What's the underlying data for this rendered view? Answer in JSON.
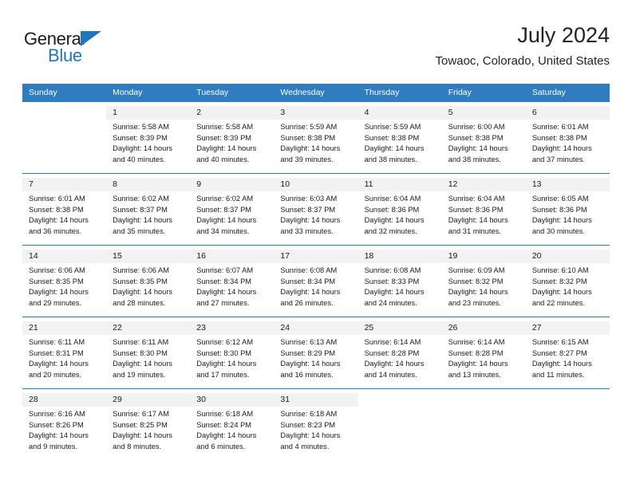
{
  "brand": {
    "name_part1": "General",
    "name_part2": "Blue",
    "accent_color": "#1f77bd"
  },
  "header": {
    "title": "July 2024",
    "subtitle": "Towaoc, Colorado, United States"
  },
  "theme": {
    "header_bg": "#2f7cc0",
    "header_text": "#ffffff",
    "daynum_band_bg": "#f2f2f2",
    "separator_color": "#2f7cc0"
  },
  "weekday_headers": [
    "Sunday",
    "Monday",
    "Tuesday",
    "Wednesday",
    "Thursday",
    "Friday",
    "Saturday"
  ],
  "labels": {
    "sunrise_prefix": "Sunrise:",
    "sunset_prefix": "Sunset:",
    "daylight_prefix": "Daylight:"
  },
  "weeks": [
    [
      {
        "day": "",
        "sunrise": "",
        "sunset": "",
        "daylight1": "",
        "daylight2": "",
        "empty": true
      },
      {
        "day": "1",
        "sunrise": "Sunrise: 5:58 AM",
        "sunset": "Sunset: 8:39 PM",
        "daylight1": "Daylight: 14 hours",
        "daylight2": "and 40 minutes.",
        "empty": false
      },
      {
        "day": "2",
        "sunrise": "Sunrise: 5:58 AM",
        "sunset": "Sunset: 8:39 PM",
        "daylight1": "Daylight: 14 hours",
        "daylight2": "and 40 minutes.",
        "empty": false
      },
      {
        "day": "3",
        "sunrise": "Sunrise: 5:59 AM",
        "sunset": "Sunset: 8:38 PM",
        "daylight1": "Daylight: 14 hours",
        "daylight2": "and 39 minutes.",
        "empty": false
      },
      {
        "day": "4",
        "sunrise": "Sunrise: 5:59 AM",
        "sunset": "Sunset: 8:38 PM",
        "daylight1": "Daylight: 14 hours",
        "daylight2": "and 38 minutes.",
        "empty": false
      },
      {
        "day": "5",
        "sunrise": "Sunrise: 6:00 AM",
        "sunset": "Sunset: 8:38 PM",
        "daylight1": "Daylight: 14 hours",
        "daylight2": "and 38 minutes.",
        "empty": false
      },
      {
        "day": "6",
        "sunrise": "Sunrise: 6:01 AM",
        "sunset": "Sunset: 8:38 PM",
        "daylight1": "Daylight: 14 hours",
        "daylight2": "and 37 minutes.",
        "empty": false
      }
    ],
    [
      {
        "day": "7",
        "sunrise": "Sunrise: 6:01 AM",
        "sunset": "Sunset: 8:38 PM",
        "daylight1": "Daylight: 14 hours",
        "daylight2": "and 36 minutes.",
        "empty": false
      },
      {
        "day": "8",
        "sunrise": "Sunrise: 6:02 AM",
        "sunset": "Sunset: 8:37 PM",
        "daylight1": "Daylight: 14 hours",
        "daylight2": "and 35 minutes.",
        "empty": false
      },
      {
        "day": "9",
        "sunrise": "Sunrise: 6:02 AM",
        "sunset": "Sunset: 8:37 PM",
        "daylight1": "Daylight: 14 hours",
        "daylight2": "and 34 minutes.",
        "empty": false
      },
      {
        "day": "10",
        "sunrise": "Sunrise: 6:03 AM",
        "sunset": "Sunset: 8:37 PM",
        "daylight1": "Daylight: 14 hours",
        "daylight2": "and 33 minutes.",
        "empty": false
      },
      {
        "day": "11",
        "sunrise": "Sunrise: 6:04 AM",
        "sunset": "Sunset: 8:36 PM",
        "daylight1": "Daylight: 14 hours",
        "daylight2": "and 32 minutes.",
        "empty": false
      },
      {
        "day": "12",
        "sunrise": "Sunrise: 6:04 AM",
        "sunset": "Sunset: 8:36 PM",
        "daylight1": "Daylight: 14 hours",
        "daylight2": "and 31 minutes.",
        "empty": false
      },
      {
        "day": "13",
        "sunrise": "Sunrise: 6:05 AM",
        "sunset": "Sunset: 8:36 PM",
        "daylight1": "Daylight: 14 hours",
        "daylight2": "and 30 minutes.",
        "empty": false
      }
    ],
    [
      {
        "day": "14",
        "sunrise": "Sunrise: 6:06 AM",
        "sunset": "Sunset: 8:35 PM",
        "daylight1": "Daylight: 14 hours",
        "daylight2": "and 29 minutes.",
        "empty": false
      },
      {
        "day": "15",
        "sunrise": "Sunrise: 6:06 AM",
        "sunset": "Sunset: 8:35 PM",
        "daylight1": "Daylight: 14 hours",
        "daylight2": "and 28 minutes.",
        "empty": false
      },
      {
        "day": "16",
        "sunrise": "Sunrise: 6:07 AM",
        "sunset": "Sunset: 8:34 PM",
        "daylight1": "Daylight: 14 hours",
        "daylight2": "and 27 minutes.",
        "empty": false
      },
      {
        "day": "17",
        "sunrise": "Sunrise: 6:08 AM",
        "sunset": "Sunset: 8:34 PM",
        "daylight1": "Daylight: 14 hours",
        "daylight2": "and 26 minutes.",
        "empty": false
      },
      {
        "day": "18",
        "sunrise": "Sunrise: 6:08 AM",
        "sunset": "Sunset: 8:33 PM",
        "daylight1": "Daylight: 14 hours",
        "daylight2": "and 24 minutes.",
        "empty": false
      },
      {
        "day": "19",
        "sunrise": "Sunrise: 6:09 AM",
        "sunset": "Sunset: 8:32 PM",
        "daylight1": "Daylight: 14 hours",
        "daylight2": "and 23 minutes.",
        "empty": false
      },
      {
        "day": "20",
        "sunrise": "Sunrise: 6:10 AM",
        "sunset": "Sunset: 8:32 PM",
        "daylight1": "Daylight: 14 hours",
        "daylight2": "and 22 minutes.",
        "empty": false
      }
    ],
    [
      {
        "day": "21",
        "sunrise": "Sunrise: 6:11 AM",
        "sunset": "Sunset: 8:31 PM",
        "daylight1": "Daylight: 14 hours",
        "daylight2": "and 20 minutes.",
        "empty": false
      },
      {
        "day": "22",
        "sunrise": "Sunrise: 6:11 AM",
        "sunset": "Sunset: 8:30 PM",
        "daylight1": "Daylight: 14 hours",
        "daylight2": "and 19 minutes.",
        "empty": false
      },
      {
        "day": "23",
        "sunrise": "Sunrise: 6:12 AM",
        "sunset": "Sunset: 8:30 PM",
        "daylight1": "Daylight: 14 hours",
        "daylight2": "and 17 minutes.",
        "empty": false
      },
      {
        "day": "24",
        "sunrise": "Sunrise: 6:13 AM",
        "sunset": "Sunset: 8:29 PM",
        "daylight1": "Daylight: 14 hours",
        "daylight2": "and 16 minutes.",
        "empty": false
      },
      {
        "day": "25",
        "sunrise": "Sunrise: 6:14 AM",
        "sunset": "Sunset: 8:28 PM",
        "daylight1": "Daylight: 14 hours",
        "daylight2": "and 14 minutes.",
        "empty": false
      },
      {
        "day": "26",
        "sunrise": "Sunrise: 6:14 AM",
        "sunset": "Sunset: 8:28 PM",
        "daylight1": "Daylight: 14 hours",
        "daylight2": "and 13 minutes.",
        "empty": false
      },
      {
        "day": "27",
        "sunrise": "Sunrise: 6:15 AM",
        "sunset": "Sunset: 8:27 PM",
        "daylight1": "Daylight: 14 hours",
        "daylight2": "and 11 minutes.",
        "empty": false
      }
    ],
    [
      {
        "day": "28",
        "sunrise": "Sunrise: 6:16 AM",
        "sunset": "Sunset: 8:26 PM",
        "daylight1": "Daylight: 14 hours",
        "daylight2": "and 9 minutes.",
        "empty": false
      },
      {
        "day": "29",
        "sunrise": "Sunrise: 6:17 AM",
        "sunset": "Sunset: 8:25 PM",
        "daylight1": "Daylight: 14 hours",
        "daylight2": "and 8 minutes.",
        "empty": false
      },
      {
        "day": "30",
        "sunrise": "Sunrise: 6:18 AM",
        "sunset": "Sunset: 8:24 PM",
        "daylight1": "Daylight: 14 hours",
        "daylight2": "and 6 minutes.",
        "empty": false
      },
      {
        "day": "31",
        "sunrise": "Sunrise: 6:18 AM",
        "sunset": "Sunset: 8:23 PM",
        "daylight1": "Daylight: 14 hours",
        "daylight2": "and 4 minutes.",
        "empty": false
      },
      {
        "day": "",
        "sunrise": "",
        "sunset": "",
        "daylight1": "",
        "daylight2": "",
        "empty": true
      },
      {
        "day": "",
        "sunrise": "",
        "sunset": "",
        "daylight1": "",
        "daylight2": "",
        "empty": true
      },
      {
        "day": "",
        "sunrise": "",
        "sunset": "",
        "daylight1": "",
        "daylight2": "",
        "empty": true
      }
    ]
  ]
}
